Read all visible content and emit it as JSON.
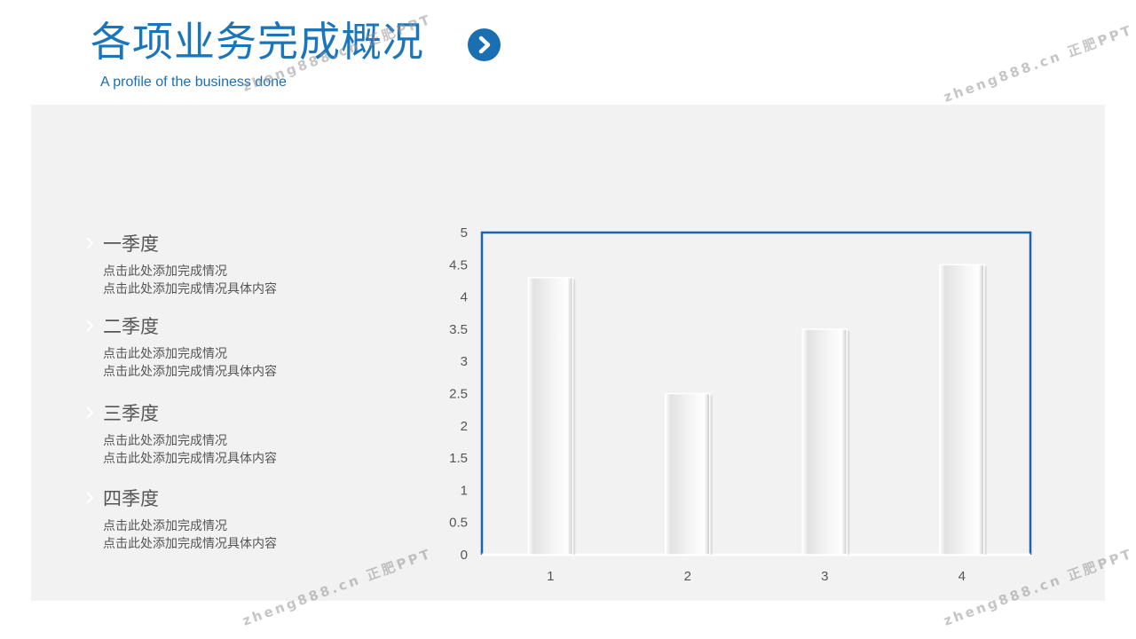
{
  "header": {
    "title": "各项业务完成概况",
    "subtitle": "A profile of the business done"
  },
  "quarters": [
    {
      "title": "一季度",
      "line1": "点击此处添加完成情况",
      "line2": "点击此处添加完成情况具体内容"
    },
    {
      "title": "二季度",
      "line1": "点击此处添加完成情况",
      "line2": "点击此处添加完成情况具体内容"
    },
    {
      "title": "三季度",
      "line1": "点击此处添加完成情况",
      "line2": "点击此处添加完成情况具体内容"
    },
    {
      "title": "四季度",
      "line1": "点击此处添加完成情况",
      "line2": "点击此处添加完成情况具体内容"
    }
  ],
  "watermarks": [
    "zheng888.cn 正肥PPT",
    "zheng888.cn 正肥PPT",
    "zheng888.cn 正肥PPT",
    "zheng888.cn 正肥PPT"
  ],
  "colors": {
    "accent": "#1a75bb",
    "frame": "#1f64a8",
    "panel": "#f2f2f2",
    "text": "#555555"
  },
  "chart_data": {
    "type": "bar",
    "categories": [
      "1",
      "2",
      "3",
      "4"
    ],
    "values": [
      4.3,
      2.5,
      3.5,
      4.5
    ],
    "ylim": [
      0,
      5
    ],
    "yticks": [
      "0",
      "0.5",
      "1",
      "1.5",
      "2",
      "2.5",
      "3",
      "3.5",
      "4",
      "4.5",
      "5"
    ],
    "title": "",
    "xlabel": "",
    "ylabel": "",
    "grid": false,
    "legend": "none"
  }
}
